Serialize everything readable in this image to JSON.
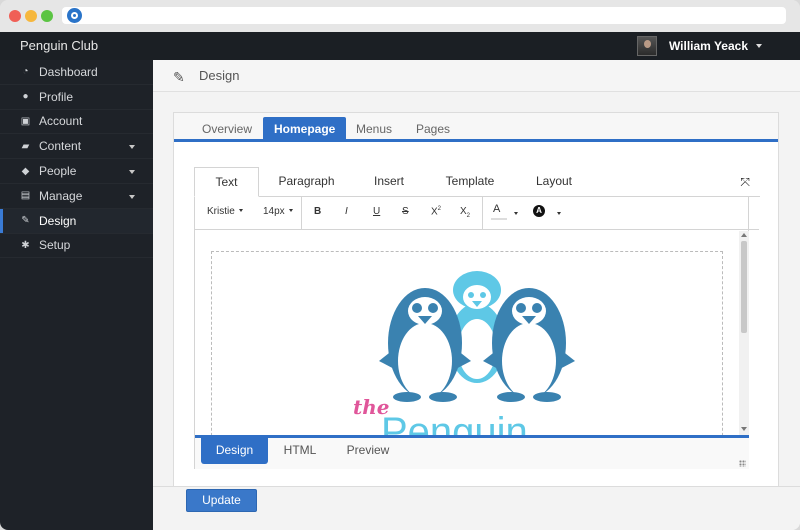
{
  "app": {
    "name": "Penguin Club"
  },
  "user": {
    "name": "William Yeack"
  },
  "sidebar": {
    "items": [
      {
        "label": "Dashboard",
        "icon": "dashboard-icon",
        "has_submenu": false,
        "active": false
      },
      {
        "label": "Profile",
        "icon": "user-icon",
        "has_submenu": false,
        "active": false
      },
      {
        "label": "Account",
        "icon": "briefcase-icon",
        "has_submenu": false,
        "active": false
      },
      {
        "label": "Content",
        "icon": "folder-icon",
        "has_submenu": true,
        "active": false
      },
      {
        "label": "People",
        "icon": "people-icon",
        "has_submenu": true,
        "active": false
      },
      {
        "label": "Manage",
        "icon": "manage-icon",
        "has_submenu": true,
        "active": false
      },
      {
        "label": "Design",
        "icon": "palette-icon",
        "has_submenu": false,
        "active": true
      },
      {
        "label": "Setup",
        "icon": "gear-icon",
        "has_submenu": false,
        "active": false
      }
    ]
  },
  "page": {
    "title": "Design",
    "icon": "palette-icon"
  },
  "main_tabs": [
    {
      "label": "Overview",
      "active": false
    },
    {
      "label": "Homepage",
      "active": true
    },
    {
      "label": "Menus",
      "active": false
    },
    {
      "label": "Pages",
      "active": false
    }
  ],
  "editor": {
    "tabs": [
      {
        "label": "Text",
        "active": true
      },
      {
        "label": "Paragraph",
        "active": false
      },
      {
        "label": "Insert",
        "active": false
      },
      {
        "label": "Template",
        "active": false
      },
      {
        "label": "Layout",
        "active": false
      }
    ],
    "toolbar": {
      "font": "Kristie",
      "size": "14px",
      "bold": "B",
      "italic": "I",
      "underline": "U",
      "strike": "S",
      "sup_base": "X",
      "sup_mark": "2",
      "sub_base": "X",
      "sub_mark": "2",
      "font_color": "A",
      "bg_color": "A"
    },
    "logo": {
      "text_the": "the",
      "text_main": "Penguin"
    },
    "bottom_tabs": [
      {
        "label": "Design",
        "active": true
      },
      {
        "label": "HTML",
        "active": false
      },
      {
        "label": "Preview",
        "active": false
      }
    ]
  },
  "footer": {
    "update_label": "Update"
  },
  "colors": {
    "accent": "#2f6fc6",
    "sidebar": "#1e2228",
    "penguin_dark": "#3a82b0",
    "penguin_light": "#5ec8e6",
    "logo_pink": "#e0569a"
  }
}
